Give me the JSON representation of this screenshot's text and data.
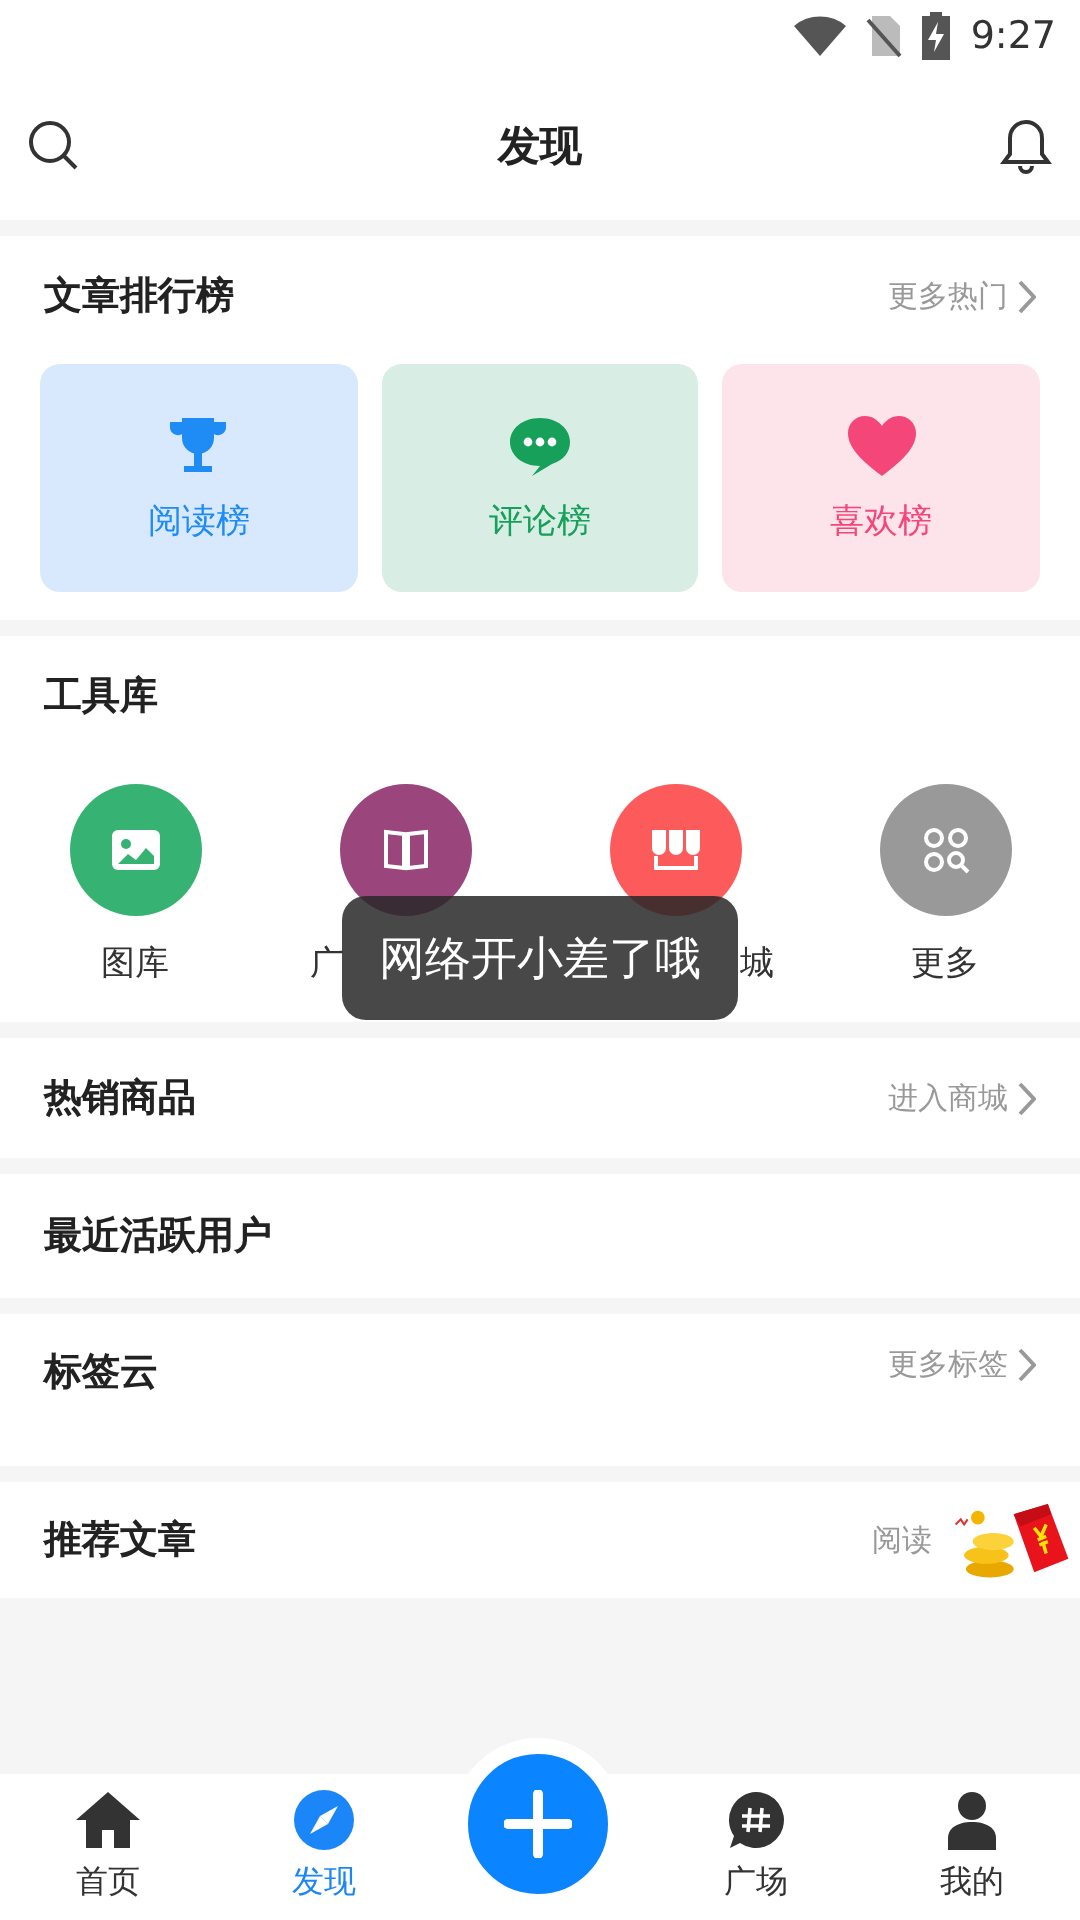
{
  "status_bar": {
    "time": "9:27"
  },
  "header": {
    "title": "发现"
  },
  "ranking": {
    "title": "文章排行榜",
    "more": "更多热门",
    "cards": [
      {
        "kind": "trophy",
        "label": "阅读榜"
      },
      {
        "kind": "chat",
        "label": "评论榜"
      },
      {
        "kind": "heart",
        "label": "喜欢榜"
      }
    ]
  },
  "tools": {
    "title": "工具库",
    "items": [
      {
        "kind": "gallery",
        "label": "图库",
        "color": "#36b273"
      },
      {
        "kind": "book",
        "label": "广",
        "color": "#9b457d"
      },
      {
        "kind": "shop",
        "label": "城",
        "color": "#fd5b5b"
      },
      {
        "kind": "more",
        "label": "更多",
        "color": "#999999"
      }
    ]
  },
  "sections": [
    {
      "title": "热销商品",
      "more": "进入商城"
    },
    {
      "title": "最近活跃用户"
    },
    {
      "title": "标签云",
      "more": "更多标签"
    },
    {
      "title": "推荐文章",
      "more": "阅读"
    }
  ],
  "toast": "网络开小差了哦",
  "bottom_nav": [
    {
      "kind": "home",
      "label": "首页",
      "selected": false
    },
    {
      "kind": "compass",
      "label": "发现",
      "selected": true
    },
    {
      "kind": "add"
    },
    {
      "kind": "hash",
      "label": "广场",
      "selected": false
    },
    {
      "kind": "user",
      "label": "我的",
      "selected": false
    }
  ]
}
